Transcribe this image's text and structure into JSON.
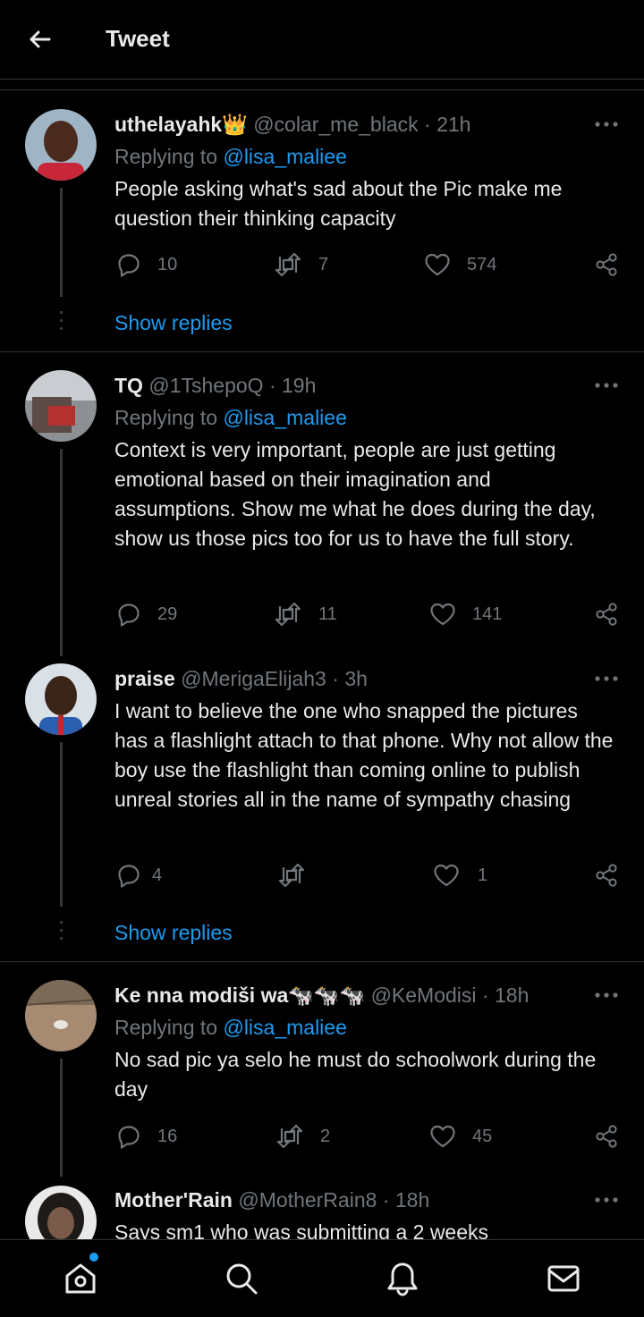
{
  "header": {
    "title": "Tweet"
  },
  "colors": {
    "accent": "#1d9bf0",
    "muted": "#71767b",
    "text": "#e7e9ea",
    "background": "#000000"
  },
  "tweets": [
    {
      "name": "uthelayahk",
      "name_emoji": "👑",
      "handle": "@colar_me_black",
      "time": "21h",
      "replying_prefix": "Replying to ",
      "replying_to": "@lisa_maliee",
      "text": "People asking what's sad about the Pic make me question their thinking capacity",
      "replies": "10",
      "retweets": "7",
      "likes": "574",
      "show_replies": "Show replies"
    },
    {
      "name": "TQ",
      "handle": "@1TshepoQ",
      "time": "19h",
      "replying_prefix": "Replying to ",
      "replying_to": "@lisa_maliee",
      "text": "Context is very important, people are just getting emotional based on their imagination and assumptions. Show me what he does during the day, show us those pics too for us to have the full story.",
      "replies": "29",
      "retweets": "11",
      "likes": "141"
    },
    {
      "name": "praise",
      "handle": "@MerigaElijah3",
      "time": "3h",
      "text": "I want to believe the one who snapped the pictures has a flashlight attach to that phone. Why not allow the boy use the flashlight than coming online to publish unreal stories all in the name of sympathy chasing",
      "replies": "4",
      "retweets": "",
      "likes": "1",
      "show_replies": "Show replies"
    },
    {
      "name": "Ke nna modiši wa",
      "name_emoji": "🐄🐄🐄",
      "handle": "@KeModisi",
      "time": "18h",
      "replying_prefix": "Replying to ",
      "replying_to": "@lisa_maliee",
      "text": "No sad pic  ya selo he must do schoolwork during the day",
      "replies": "16",
      "retweets": "2",
      "likes": "45"
    },
    {
      "name": "Mother'Rain",
      "handle": "@MotherRain8",
      "time": "18h",
      "text": "Says sm1 who was submitting a 2 weeks"
    }
  ],
  "icons": {
    "back": "arrow-left-icon",
    "more": "more-horizontal-icon",
    "reply": "reply-bubble-icon",
    "retweet": "retweet-icon",
    "like": "heart-icon",
    "share": "share-icon",
    "home": "home-icon",
    "search": "search-icon",
    "notifications": "bell-icon",
    "messages": "mail-icon"
  }
}
